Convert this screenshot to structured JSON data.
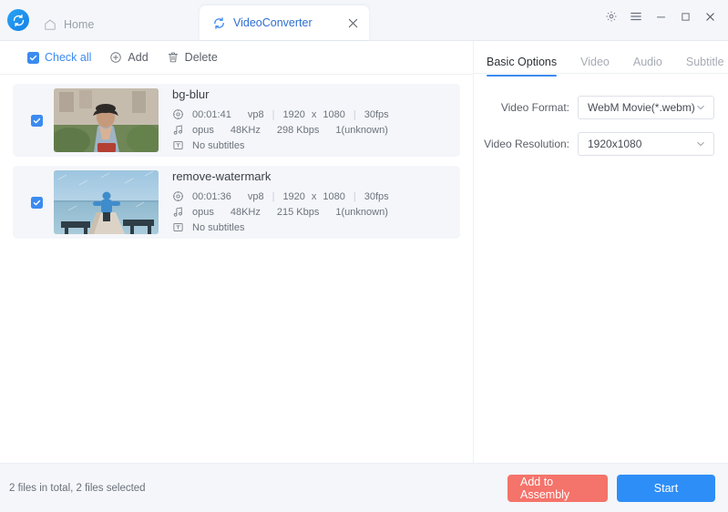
{
  "window": {
    "logo_icon": "app-logo-icon",
    "home_tab": {
      "label": "Home",
      "icon": "home-icon"
    },
    "active_tab": {
      "label": "VideoConverter",
      "icon": "refresh-icon",
      "close_icon": "close-icon"
    },
    "controls": {
      "settings_icon": "gear-icon",
      "menu_icon": "hamburger-menu-icon",
      "minimize_icon": "minimize-icon",
      "maximize_icon": "maximize-icon",
      "close_icon": "close-icon"
    }
  },
  "toolbar": {
    "check_all_label": "Check all",
    "add_label": "Add",
    "delete_label": "Delete",
    "check_all_icon": "checkbox-checked-icon",
    "add_icon": "plus-circle-icon",
    "delete_icon": "trash-icon"
  },
  "files": [
    {
      "name": "bg-blur",
      "checked": true,
      "duration": "00:01:41",
      "video_codec": "vp8",
      "width": "1920",
      "x": "x",
      "height": "1080",
      "fps": "30fps",
      "audio_codec": "opus",
      "sample_rate": "48KHz",
      "bitrate": "298 Kbps",
      "channels": "1(unknown)",
      "subtitles": "No subtitles",
      "video_icon": "video-disc-icon",
      "audio_icon": "music-note-icon",
      "subtitle_icon": "subtitle-text-icon",
      "thumbnail": "woman-reading-in-garden"
    },
    {
      "name": "remove-watermark",
      "checked": true,
      "duration": "00:01:36",
      "video_codec": "vp8",
      "width": "1920",
      "x": "x",
      "height": "1080",
      "fps": "30fps",
      "audio_codec": "opus",
      "sample_rate": "48KHz",
      "bitrate": "215 Kbps",
      "channels": "1(unknown)",
      "subtitles": "No subtitles",
      "video_icon": "video-disc-icon",
      "audio_icon": "music-note-icon",
      "subtitle_icon": "subtitle-text-icon",
      "thumbnail": "person-on-pier-by-sea"
    }
  ],
  "panel": {
    "tabs": [
      {
        "label": "Basic Options",
        "active": true
      },
      {
        "label": "Video",
        "active": false
      },
      {
        "label": "Audio",
        "active": false
      },
      {
        "label": "Subtitle",
        "active": false
      }
    ],
    "video_format": {
      "label": "Video Format:",
      "value": "WebM Movie(*.webm)",
      "chevron_icon": "chevron-down-icon"
    },
    "video_resolution": {
      "label": "Video Resolution:",
      "value": "1920x1080",
      "chevron_icon": "chevron-down-icon"
    }
  },
  "footer": {
    "status": "2 files in total, 2 files selected",
    "add_to_assembly_label": "Add to Assembly",
    "start_label": "Start"
  },
  "colors": {
    "accent_blue": "#3b8bf0",
    "start_blue": "#2e8ef7",
    "assembly_red": "#f4736a",
    "row_bg": "#f4f6fa",
    "tab_blue": "#2f6fd0"
  }
}
